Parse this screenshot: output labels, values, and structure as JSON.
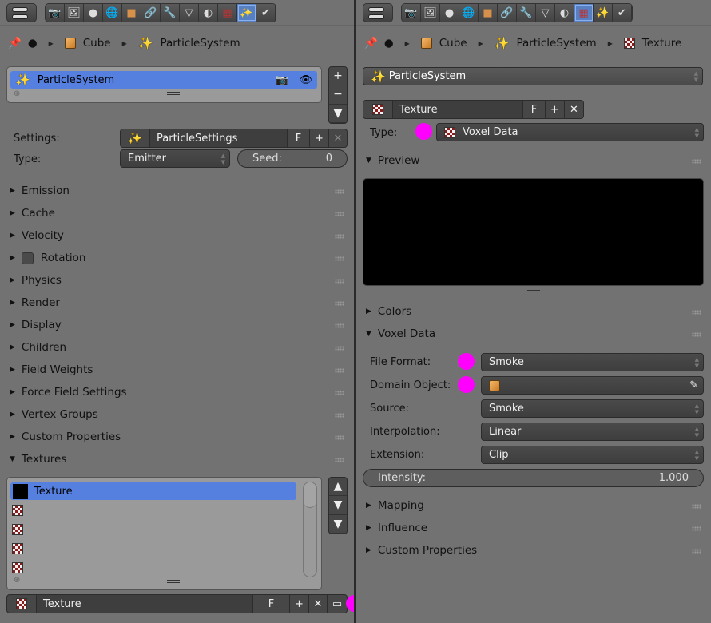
{
  "colors": {
    "accent": "#5680e0",
    "marker": "#ff00ff",
    "panel_bg": "#727272"
  },
  "toolbar_icons": [
    "render",
    "render-layers",
    "scene",
    "world",
    "object",
    "constraints",
    "modifiers",
    "data",
    "material",
    "texture",
    "particles",
    "physics"
  ],
  "left": {
    "active_tab": "particles",
    "breadcrumb": [
      "Cube",
      "ParticleSystem"
    ],
    "particle_list": {
      "items": [
        {
          "label": "ParticleSystem"
        }
      ]
    },
    "settings_label": "Settings:",
    "settings_value": "ParticleSettings",
    "fake_user": "F",
    "type_label": "Type:",
    "type_value": "Emitter",
    "seed_label": "Seed:",
    "seed_value": "0",
    "panels": [
      "Emission",
      "Cache",
      "Velocity",
      "Rotation",
      "Physics",
      "Render",
      "Display",
      "Children",
      "Field Weights",
      "Force Field Settings",
      "Vertex Groups",
      "Custom Properties",
      "Textures"
    ],
    "rotation_checkbox": false,
    "texture_slots": [
      "Texture",
      "",
      "",
      "",
      ""
    ],
    "texture_name": "Texture",
    "texture_fake_user": "F"
  },
  "right": {
    "active_tab": "texture",
    "breadcrumb": [
      "Cube",
      "ParticleSystem",
      "Texture"
    ],
    "context_value": "ParticleSystem",
    "texture_name": "Texture",
    "fake_user": "F",
    "type_label": "Type:",
    "type_value": "Voxel Data",
    "preview_label": "Preview",
    "colors_label": "Colors",
    "voxel_label": "Voxel Data",
    "fields": [
      {
        "label": "File Format:",
        "value": "Smoke",
        "marker": true
      },
      {
        "label": "Domain Object:",
        "value": "",
        "marker": true
      },
      {
        "label": "Source:",
        "value": "Smoke",
        "marker": false
      },
      {
        "label": "Interpolation:",
        "value": "Linear",
        "marker": false
      },
      {
        "label": "Extension:",
        "value": "Clip",
        "marker": false
      }
    ],
    "intensity_label": "Intensity:",
    "intensity_value": "1.000",
    "bottom_panels": [
      "Mapping",
      "Influence",
      "Custom Properties"
    ]
  }
}
